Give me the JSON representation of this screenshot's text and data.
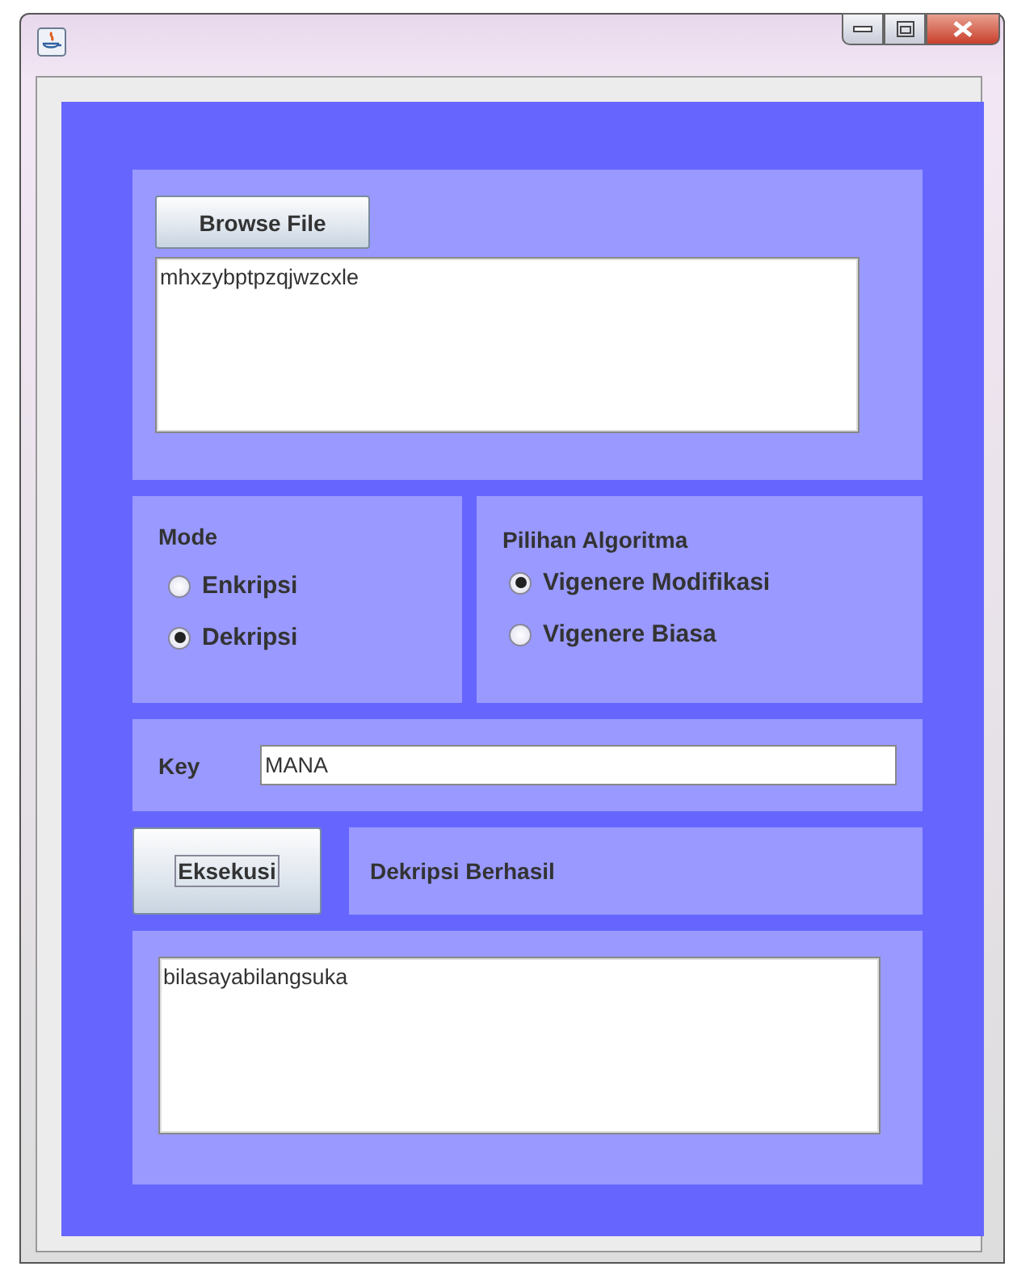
{
  "browse_button": "Browse File",
  "input_text": "mhxzybptpzqjwzcxle",
  "mode": {
    "title": "Mode",
    "options": [
      {
        "label": "Enkripsi",
        "selected": false
      },
      {
        "label": "Dekripsi",
        "selected": true
      }
    ]
  },
  "algorithm": {
    "title": "Pilihan Algoritma",
    "options": [
      {
        "label": "Vigenere Modifikasi",
        "selected": true
      },
      {
        "label": "Vigenere Biasa",
        "selected": false
      }
    ]
  },
  "key": {
    "label": "Key",
    "value": "MANA"
  },
  "execute_button": "Eksekusi",
  "status": "Dekripsi Berhasil",
  "output_text": "bilasayabilangsuka"
}
